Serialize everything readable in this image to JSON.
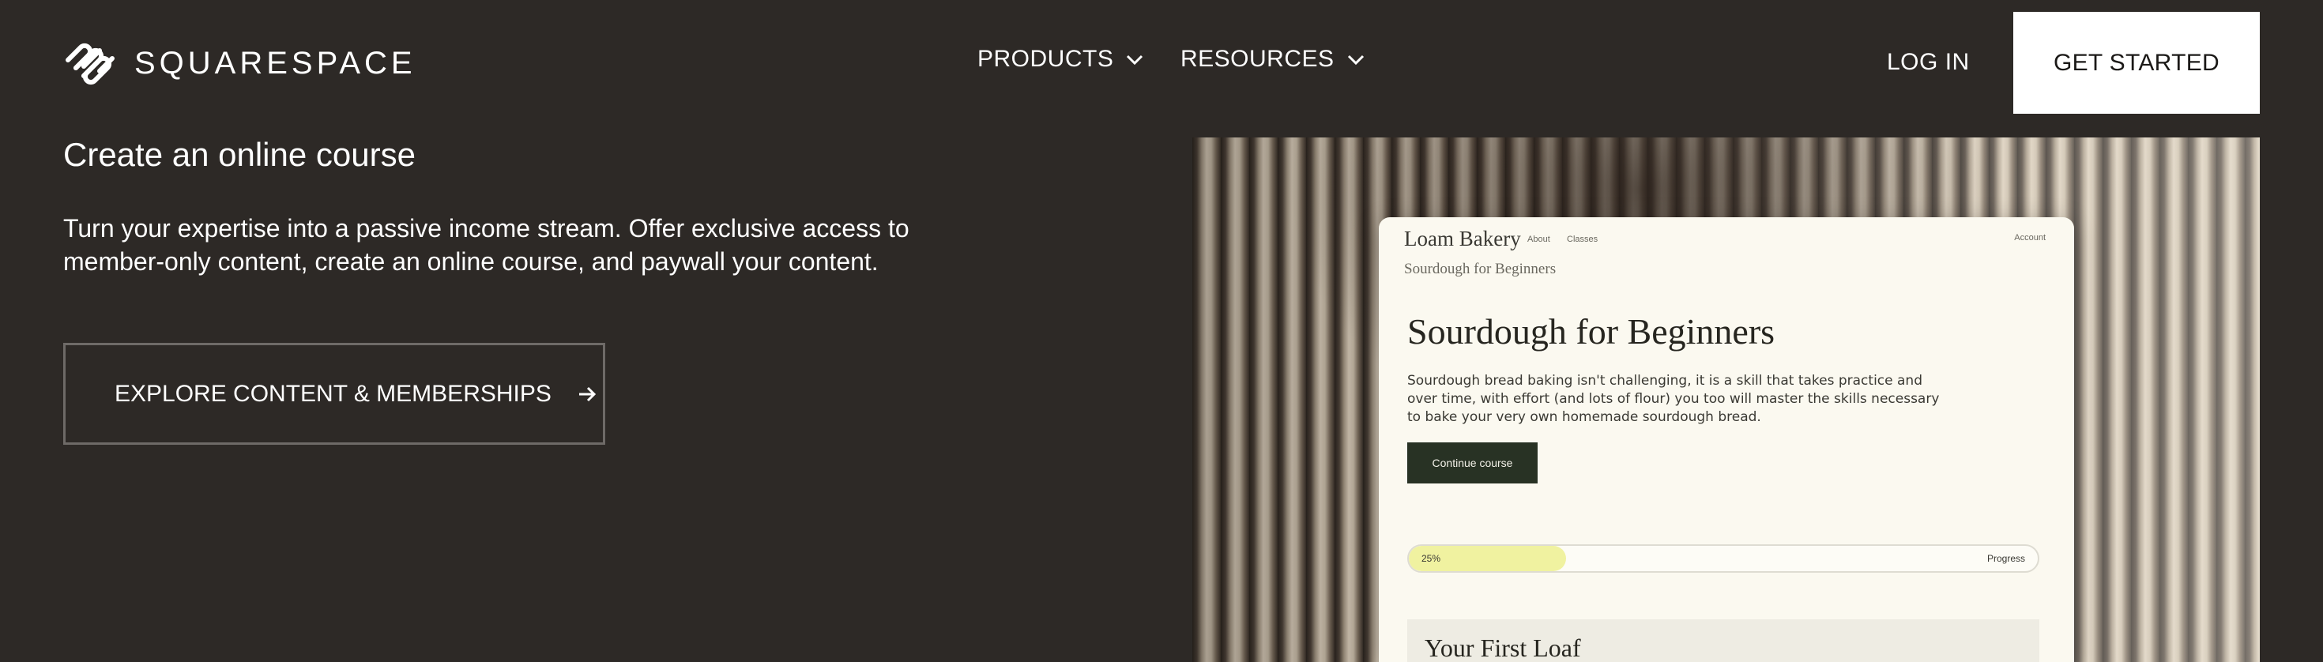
{
  "header": {
    "brand": "SQUARESPACE",
    "nav": [
      {
        "label": "PRODUCTS"
      },
      {
        "label": "RESOURCES"
      }
    ],
    "login_label": "LOG IN",
    "cta_label": "GET STARTED"
  },
  "main": {
    "heading": "Create an online course",
    "description": "Turn your expertise into a passive income stream. Offer exclusive access to member-only content, create an online course, and paywall your content.",
    "explore_label": "EXPLORE CONTENT & MEMBERSHIPS"
  },
  "preview": {
    "brand": "Loam Bakery",
    "nav": [
      "About",
      "Classes"
    ],
    "account": "Account",
    "breadcrumb": "Sourdough for Beginners",
    "title": "Sourdough for Beginners",
    "body": "Sourdough bread baking isn't challenging, it is a skill that takes practice and over time, with effort (and lots of flour) you too will master the skills necessary to bake your very own homemade sourdough bread.",
    "continue_label": "Continue course",
    "progress_percent": 25,
    "progress_text": "25%",
    "progress_label": "Progress",
    "lesson_title": "Your First Loaf"
  },
  "colors": {
    "page_background": "#2d2926",
    "text": "#ffffff",
    "cta_background": "#ffffff",
    "cta_text": "#1b1917",
    "preview_button": "#283224",
    "progress_fill": "#f0f2a0"
  },
  "icons": [
    "squarespace-logo-icon",
    "chevron-down-icon",
    "arrow-right-icon"
  ]
}
